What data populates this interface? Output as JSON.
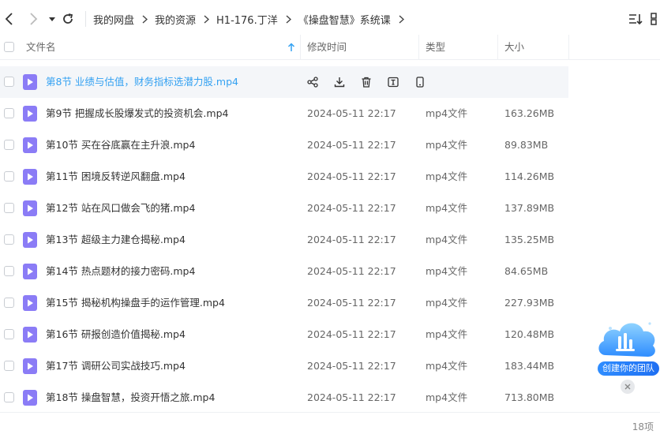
{
  "breadcrumb": [
    "我的网盘",
    "我的资源",
    "H1-176.丁洋",
    "《操盘智慧》系统课"
  ],
  "header": {
    "name": "文件名",
    "modified": "修改时间",
    "type": "类型",
    "size": "大小"
  },
  "files": [
    {
      "name": "第8节 业绩与估值，财务指标选潜力股.mp4",
      "date": "",
      "type": "",
      "size": ""
    },
    {
      "name": "第9节 把握成长股爆发式的投资机会.mp4",
      "date": "2024-05-11 22:17",
      "type": "mp4文件",
      "size": "163.26MB"
    },
    {
      "name": "第10节 买在谷底赢在主升浪.mp4",
      "date": "2024-05-11 22:17",
      "type": "mp4文件",
      "size": "89.83MB"
    },
    {
      "name": "第11节 困境反转逆风翻盘.mp4",
      "date": "2024-05-11 22:17",
      "type": "mp4文件",
      "size": "114.26MB"
    },
    {
      "name": "第12节 站在风口做会飞的猪.mp4",
      "date": "2024-05-11 22:17",
      "type": "mp4文件",
      "size": "137.89MB"
    },
    {
      "name": "第13节 超级主力建仓揭秘.mp4",
      "date": "2024-05-11 22:17",
      "type": "mp4文件",
      "size": "135.25MB"
    },
    {
      "name": "第14节 热点题材的接力密码.mp4",
      "date": "2024-05-11 22:17",
      "type": "mp4文件",
      "size": "84.65MB"
    },
    {
      "name": "第15节 揭秘机构操盘手的运作管理.mp4",
      "date": "2024-05-11 22:17",
      "type": "mp4文件",
      "size": "227.93MB"
    },
    {
      "name": "第16节 研报创造价值揭秘.mp4",
      "date": "2024-05-11 22:17",
      "type": "mp4文件",
      "size": "120.48MB"
    },
    {
      "name": "第17节 调研公司实战技巧.mp4",
      "date": "2024-05-11 22:17",
      "type": "mp4文件",
      "size": "183.44MB"
    },
    {
      "name": "第18节 操盘智慧，投资开悟之旅.mp4",
      "date": "2024-05-11 22:17",
      "type": "mp4文件",
      "size": "713.80MB"
    }
  ],
  "footer": {
    "count": "18项"
  },
  "team_badge": {
    "label": "创建你的团队"
  },
  "colors": {
    "accent": "#33a1f2",
    "file_icon": "#8b7cf6",
    "hover_row": "#f4f6f9"
  }
}
